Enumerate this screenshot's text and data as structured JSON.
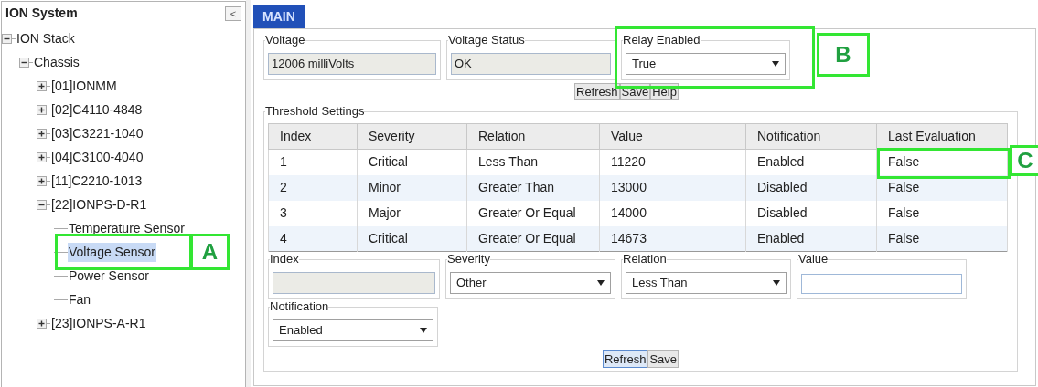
{
  "sidebar": {
    "title": "ION System",
    "collapse_button": "<",
    "tree": [
      {
        "label": "ION Stack",
        "expanded": true,
        "selected": false,
        "children": [
          {
            "label": "Chassis",
            "expanded": true,
            "selected": false,
            "children": [
              {
                "label": "[01]IONMM",
                "expanded": false,
                "selected": false
              },
              {
                "label": "[02]C4110-4848",
                "expanded": false,
                "selected": false
              },
              {
                "label": "[03]C3221-1040",
                "expanded": false,
                "selected": false
              },
              {
                "label": "[04]C3100-4040",
                "expanded": false,
                "selected": false
              },
              {
                "label": "[11]C2210-1013",
                "expanded": false,
                "selected": false
              },
              {
                "label": "[22]IONPS-D-R1",
                "expanded": true,
                "selected": false,
                "children": [
                  {
                    "label": "Temperature Sensor",
                    "selected": false
                  },
                  {
                    "label": "Voltage Sensor",
                    "selected": true,
                    "callout": "A"
                  },
                  {
                    "label": "Power Sensor",
                    "selected": false
                  },
                  {
                    "label": "Fan",
                    "selected": false
                  }
                ]
              },
              {
                "label": "[23]IONPS-A-R1",
                "expanded": false,
                "selected": false
              }
            ]
          }
        ]
      }
    ]
  },
  "tabs": [
    {
      "label": "MAIN",
      "selected": true
    }
  ],
  "status_fields": [
    {
      "kind": "readonly",
      "label": "Voltage",
      "value": "12006 milliVolts"
    },
    {
      "kind": "readonly",
      "label": "Voltage Status",
      "value": "OK"
    },
    {
      "kind": "select",
      "label": "Relay Enabled",
      "value": "True",
      "callout": "B"
    }
  ],
  "top_buttons": [
    "Refresh",
    "Save",
    "Help"
  ],
  "threshold": {
    "title": "Threshold Settings",
    "columns": [
      "Index",
      "Severity",
      "Relation",
      "Value",
      "Notification",
      "Last Evaluation"
    ],
    "rows": [
      {
        "cells": [
          "1",
          "Critical",
          "Less Than",
          "11220",
          "Enabled",
          "False"
        ],
        "callout": "C"
      },
      {
        "cells": [
          "2",
          "Minor",
          "Greater Than",
          "13000",
          "Disabled",
          "False"
        ]
      },
      {
        "cells": [
          "3",
          "Major",
          "Greater Or Equal",
          "14000",
          "Disabled",
          "False"
        ]
      },
      {
        "cells": [
          "4",
          "Critical",
          "Greater Or Equal",
          "14673",
          "Enabled",
          "False"
        ]
      }
    ],
    "form": [
      {
        "kind": "readonly",
        "label": "Index"
      },
      {
        "kind": "select",
        "label": "Severity",
        "value": "Other"
      },
      {
        "kind": "select",
        "label": "Relation",
        "value": "Less Than"
      },
      {
        "kind": "input",
        "label": "Value"
      },
      {
        "kind": "select",
        "label": "Notification",
        "value": "Enabled"
      }
    ],
    "buttons": [
      {
        "label": "Refresh",
        "selected": true
      },
      {
        "label": "Save",
        "selected": false
      }
    ]
  }
}
